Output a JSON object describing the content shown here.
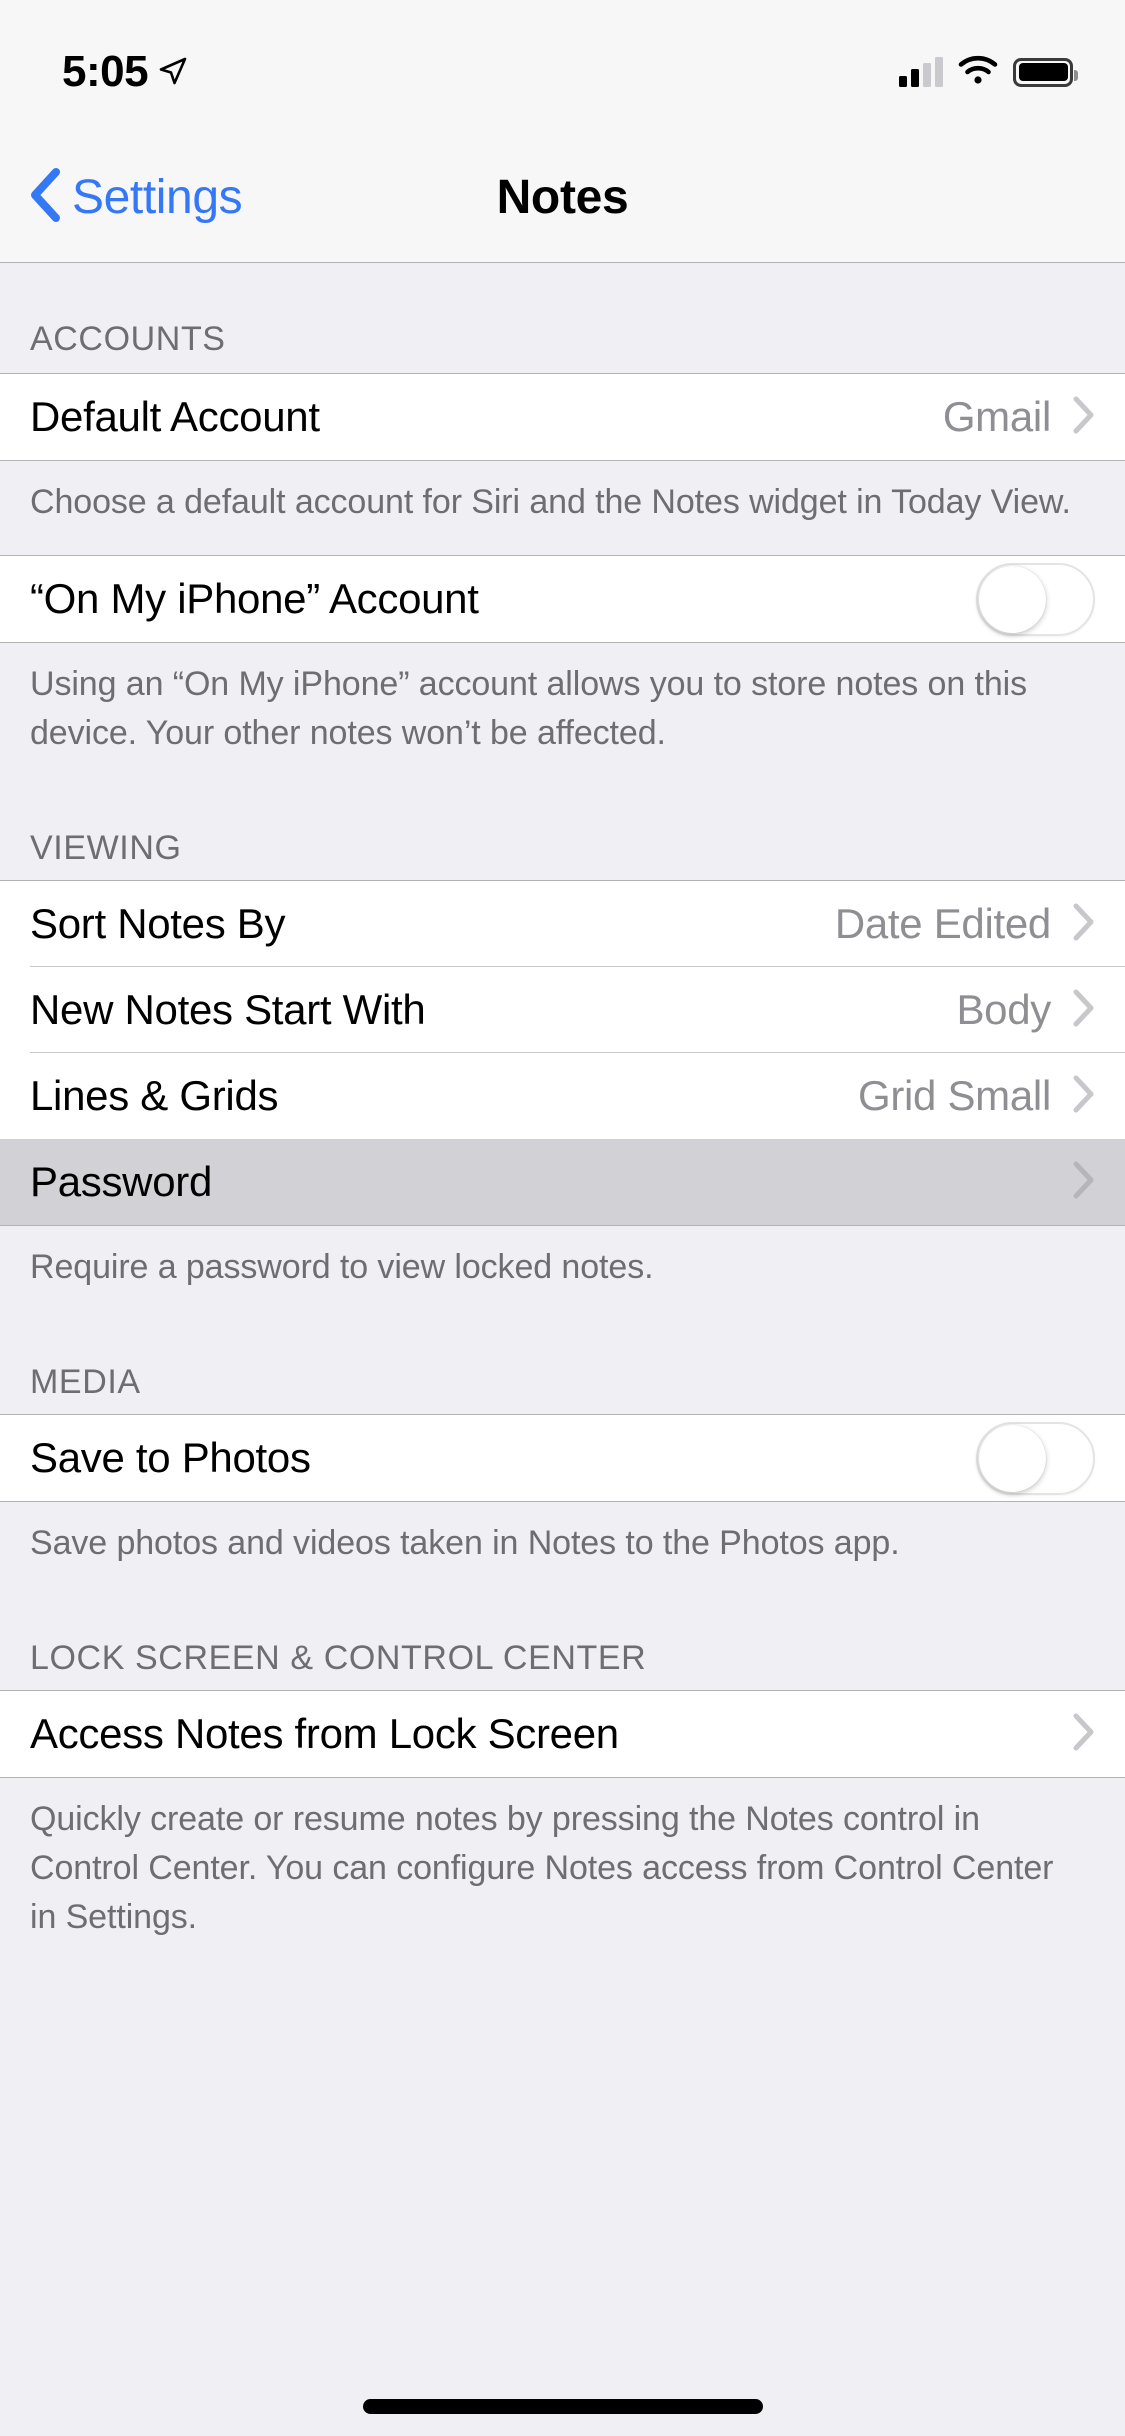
{
  "status_bar": {
    "time": "5:05",
    "location_icon": "location-arrow-icon",
    "signal_icon": "cellular-signal-icon",
    "wifi_icon": "wifi-icon",
    "battery_icon": "battery-full-icon"
  },
  "nav": {
    "back_label": "Settings",
    "back_icon": "chevron-left-icon",
    "title": "Notes"
  },
  "sections": [
    {
      "header": "ACCOUNTS",
      "rows": [
        {
          "label": "Default Account",
          "value": "Gmail",
          "accessory": "chevron-right-icon"
        }
      ],
      "footer": "Choose a default account for Siri and the Notes widget in Today View."
    },
    {
      "header": "",
      "rows": [
        {
          "label": "“On My iPhone” Account",
          "value": "",
          "accessory": "toggle-off"
        }
      ],
      "footer": "Using an “On My iPhone” account allows you to store notes on this device. Your other notes won’t be affected."
    },
    {
      "header": "VIEWING",
      "rows": [
        {
          "label": "Sort Notes By",
          "value": "Date Edited",
          "accessory": "chevron-right-icon"
        },
        {
          "label": "New Notes Start With",
          "value": "Body",
          "accessory": "chevron-right-icon"
        },
        {
          "label": "Lines & Grids",
          "value": "Grid Small",
          "accessory": "chevron-right-icon"
        },
        {
          "label": "Password",
          "value": "",
          "accessory": "chevron-right-icon",
          "state": "pressed"
        }
      ],
      "footer": "Require a password to view locked notes."
    },
    {
      "header": "MEDIA",
      "rows": [
        {
          "label": "Save to Photos",
          "value": "",
          "accessory": "toggle-off"
        }
      ],
      "footer": "Save photos and videos taken in Notes to the Photos app."
    },
    {
      "header": "LOCK SCREEN & CONTROL CENTER",
      "rows": [
        {
          "label": "Access Notes from Lock Screen",
          "value": "",
          "accessory": "chevron-right-icon"
        }
      ],
      "footer": "Quickly create or resume notes by pressing the Notes control in Control Center. You can configure Notes access from Control Center in Settings."
    }
  ],
  "colors": {
    "accent": "#3478F6",
    "group_background": "#EFEFF4",
    "cell_background": "#FFFFFF",
    "pressed_background": "#D1D1D6",
    "secondary_text": "#8E8E93",
    "header_text": "#6D6D72"
  }
}
